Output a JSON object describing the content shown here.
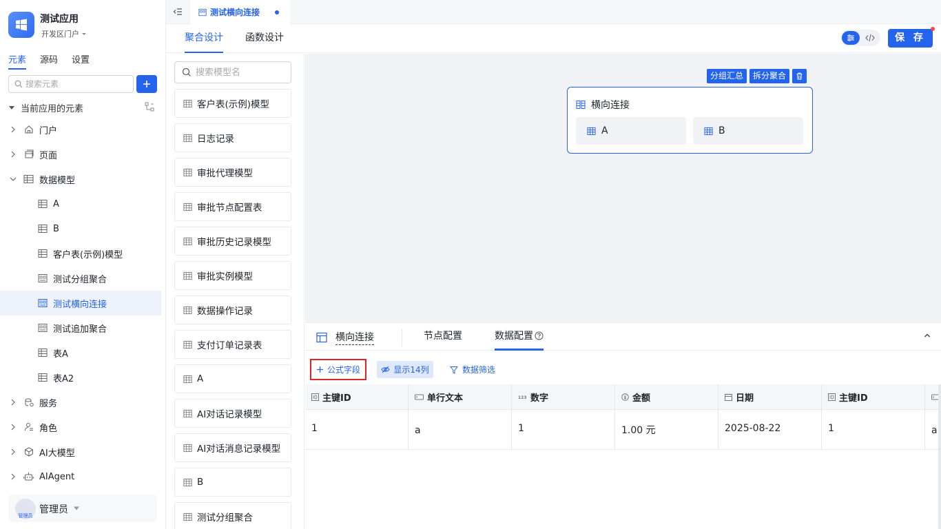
{
  "app": {
    "name": "测试应用",
    "portal": "开发区门户"
  },
  "sidebar": {
    "tabs": [
      {
        "label": "元素",
        "active": true
      },
      {
        "label": "源码"
      },
      {
        "label": "设置"
      }
    ],
    "search_placeholder": "搜索元素",
    "root_label": "当前应用的元素",
    "items": [
      {
        "label": "门户",
        "level": 0,
        "arrow": "right",
        "icon": "home-icon"
      },
      {
        "label": "页面",
        "level": 0,
        "arrow": "right",
        "icon": "page-icon"
      },
      {
        "label": "数据模型",
        "level": 0,
        "arrow": "down",
        "icon": "table-icon"
      },
      {
        "label": "A",
        "level": 1,
        "icon": "table-icon"
      },
      {
        "label": "B",
        "level": 1,
        "icon": "table-icon"
      },
      {
        "label": "客户表(示例)模型",
        "level": 1,
        "icon": "table-icon"
      },
      {
        "label": "测试分组聚合",
        "level": 1,
        "icon": "aggregate-icon"
      },
      {
        "label": "测试横向连接",
        "level": 1,
        "icon": "aggregate-icon",
        "selected": true
      },
      {
        "label": "测试追加聚合",
        "level": 1,
        "icon": "aggregate-icon"
      },
      {
        "label": "表A",
        "level": 1,
        "icon": "table-icon"
      },
      {
        "label": "表A2",
        "level": 1,
        "icon": "table-icon"
      },
      {
        "label": "服务",
        "level": 0,
        "arrow": "right",
        "icon": "service-icon"
      },
      {
        "label": "角色",
        "level": 0,
        "arrow": "right",
        "icon": "role-icon"
      },
      {
        "label": "AI大模型",
        "level": 0,
        "arrow": "right",
        "icon": "ai-model-icon"
      },
      {
        "label": "AIAgent",
        "level": 0,
        "arrow": "right",
        "icon": "robot-icon"
      }
    ],
    "user": {
      "name": "管理员",
      "avatar_text": "管理员"
    }
  },
  "tabbar": {
    "doc_tab": "测试横向连接"
  },
  "subtabs": [
    {
      "label": "聚合设计",
      "active": true
    },
    {
      "label": "函数设计"
    }
  ],
  "toolbar": {
    "save_label": "保 存"
  },
  "model_panel": {
    "search_placeholder": "搜索模型名",
    "models": [
      "客户表(示例)模型",
      "日志记录",
      "审批代理模型",
      "审批节点配置表",
      "审批历史记录模型",
      "审批实例模型",
      "数据操作记录",
      "支付订单记录表",
      "A",
      "AI对话记录模型",
      "AI对话消息记录模型",
      "B",
      "测试分组聚合"
    ]
  },
  "canvas": {
    "actions": [
      "分组汇总",
      "拆分聚合"
    ],
    "node": {
      "title": "横向连接",
      "sources": [
        "A",
        "B"
      ]
    }
  },
  "bottom": {
    "title": "横向连接",
    "tabs": [
      {
        "label": "节点配置"
      },
      {
        "label": "数据配置",
        "active": true
      }
    ],
    "formula_label": "公式字段",
    "show_label": "显示14列",
    "filter_label": "数据筛选",
    "columns": [
      {
        "label": "主键ID",
        "icon": "id-icon"
      },
      {
        "label": "单行文本",
        "icon": "text-icon"
      },
      {
        "label": "数字",
        "icon": "number-icon"
      },
      {
        "label": "金额",
        "icon": "money-icon"
      },
      {
        "label": "日期",
        "icon": "date-icon"
      },
      {
        "label": "主键ID",
        "icon": "id-icon"
      },
      {
        "label": "",
        "icon": "text-icon"
      }
    ],
    "rows": [
      [
        "1",
        "a",
        "1",
        "1.00 元",
        "2025-08-22",
        "1",
        "a"
      ]
    ]
  },
  "colors": {
    "accent": "#2463eb",
    "highlight_border": "#e02424",
    "canvas_bg": "#f1f2f5"
  }
}
